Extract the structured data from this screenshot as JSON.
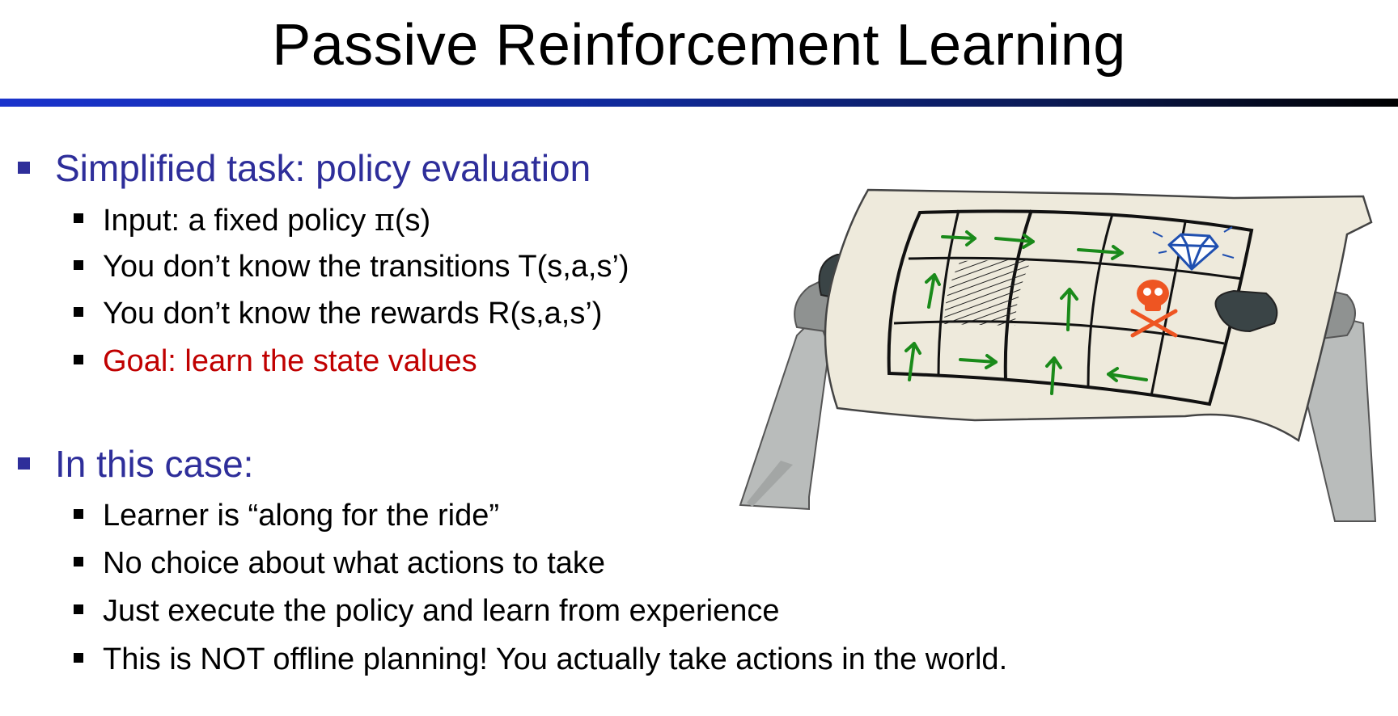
{
  "title": "Passive Reinforcement Learning",
  "sections": [
    {
      "heading": "Simplified task: policy evaluation",
      "items": [
        {
          "before": "Input: a fixed policy ",
          "symbol": "π",
          "after": "(s)"
        },
        {
          "text": "You don’t know the transitions T(s,a,s’)"
        },
        {
          "text": "You don’t know the rewards R(s,a,s’)"
        },
        {
          "text": "Goal: learn the state values"
        }
      ]
    },
    {
      "heading": "In this case:",
      "items": [
        {
          "text": "Learner is “along for the ride”"
        },
        {
          "text": "No choice about what actions to take"
        },
        {
          "text": "Just execute the policy and learn from experience"
        },
        {
          "text": "This is NOT offline planning!  You actually take actions in the world."
        }
      ]
    }
  ],
  "colors": {
    "heading": "#2e2e9a",
    "goal": "#c00000",
    "rule_start": "#1a33cc",
    "rule_end": "#000000",
    "arrows": "#1a8a1a",
    "diamond": "#1f4fb0",
    "skull": "#ee5522"
  },
  "illustration": {
    "icons": [
      "robot-hands-icon",
      "grid-map-icon",
      "diamond-icon",
      "skull-crossbones-icon",
      "policy-arrow-icon"
    ]
  }
}
